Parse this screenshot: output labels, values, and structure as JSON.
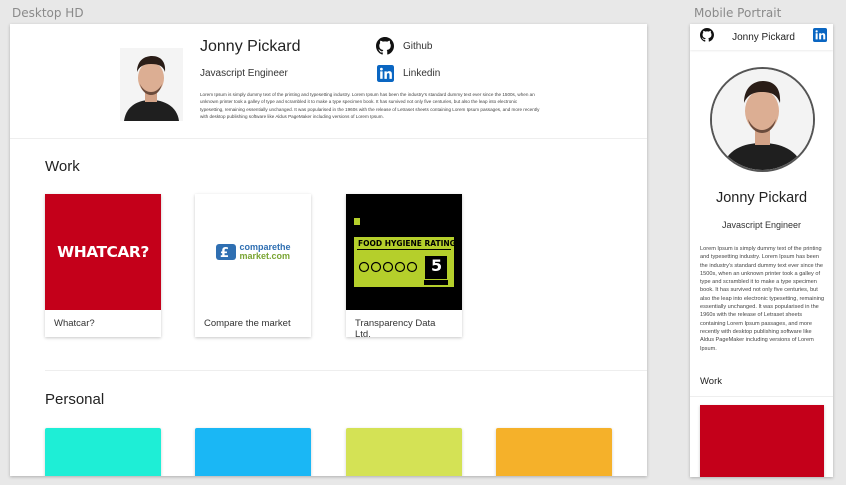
{
  "frames": {
    "desktop_label": "Desktop HD",
    "mobile_label": "Mobile Portrait"
  },
  "profile": {
    "name": "Jonny Pickard",
    "role": "Javascript Engineer",
    "bio": "Lorem Ipsum is simply dummy text of the printing and typesetting industry. Lorem Ipsum has been the industry's standard dummy text ever since the 1500s, when an unknown printer took a galley of type and scrambled it to make a type specimen book. It has survived not only five centuries, but also the leap into electronic typesetting, remaining essentially unchanged. It was popularised in the 1960s with the release of Letraset sheets containing Lorem Ipsum passages, and more recently with desktop publishing software like Aldus PageMaker including versions of Lorem Ipsum."
  },
  "social": {
    "github_label": "Github",
    "linkedin_label": "Linkedin",
    "github_icon": "github-icon",
    "linkedin_icon": "linkedin-icon",
    "linkedin_color": "#0a66c2"
  },
  "work": {
    "title": "Work",
    "items": [
      {
        "label": "Whatcar?",
        "thumb_text": "WHATCAR?",
        "thumb_color": "#c4001a"
      },
      {
        "label": "Compare the market",
        "thumb_text_1": "comparethe",
        "thumb_text_2": "market.com"
      },
      {
        "label": "Transparency Data Ltd.",
        "thumb_text": "FOOD HYGIENE RATING",
        "thumb_score": "5",
        "thumb_color": "#000000",
        "accent": "#b5cf2b"
      }
    ]
  },
  "personal": {
    "title": "Personal",
    "colors": [
      "#1eeed6",
      "#1ab7f5",
      "#d4e255",
      "#f5b12a"
    ]
  },
  "mobile": {
    "header_title": "Jonny Pickard",
    "work_title": "Work"
  }
}
